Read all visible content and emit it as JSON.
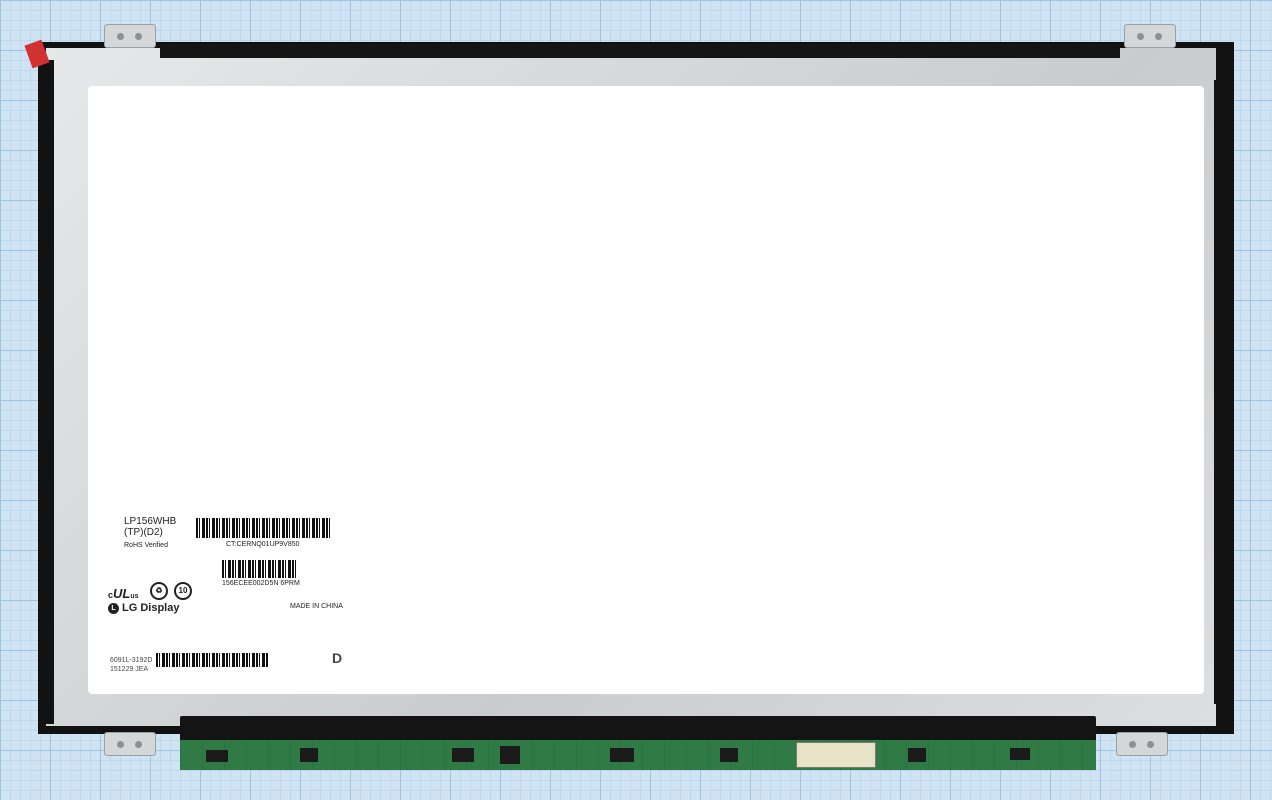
{
  "label": {
    "model_line1": "LP156WHB",
    "model_line2": "(TP)(D2)",
    "rohs": "RoHS Verified",
    "barcode1_text": "CT:CERNQ01UP9V850",
    "barcode2_text": "156ECEE002D5N  6PRM",
    "ul_mark": "c",
    "ul_us": "us",
    "ul_logo": "UL",
    "lg_brand": "LG Display",
    "origin": "MADE IN CHINA",
    "code_line1": "6091L-3192D",
    "code_line2": "151229  JEA",
    "revision_letter": "D",
    "ten_mark": "10"
  },
  "colors": {
    "grid_background": "#cfe3f3",
    "bezel": "#d9dbdc",
    "screen": "#ffffff",
    "pcb": "#2f7a45",
    "tape": "#d23131"
  }
}
